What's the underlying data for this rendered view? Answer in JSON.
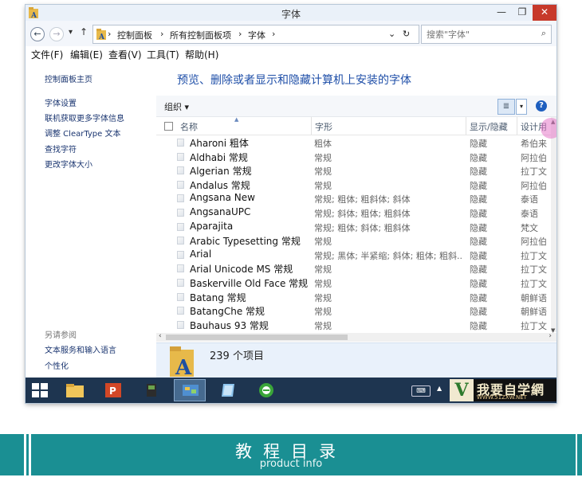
{
  "window": {
    "title": "字体",
    "min_glyph": "—",
    "max_glyph": "❐",
    "close_glyph": "✕"
  },
  "address": {
    "crumbs": [
      "控制面板",
      "所有控制面板项",
      "字体"
    ],
    "separator": "›",
    "search_placeholder": "搜索\"字体\"",
    "back_glyph": "←",
    "forward_glyph": "→",
    "recent_glyph": "▾",
    "up_glyph": "↑",
    "dropdown_glyph": "⌄",
    "refresh_glyph": "↻",
    "search_glyph": "⌕"
  },
  "menu": [
    "文件(F)",
    "编辑(E)",
    "查看(V)",
    "工具(T)",
    "帮助(H)"
  ],
  "sidebar": {
    "home": "控制面板主页",
    "links": [
      "字体设置",
      "联机获取更多字体信息",
      "调整 ClearType 文本",
      "查找字符",
      "更改字体大小"
    ],
    "see_also": "另请参阅",
    "see_also_links": [
      "文本服务和输入语言",
      "个性化"
    ]
  },
  "main": {
    "heading": "预览、删除或者显示和隐藏计算机上安装的字体",
    "organize": "组织 ▾",
    "view_glyph": "≣",
    "view_dd": "▾",
    "help": "?",
    "columns": {
      "name": "名称",
      "style": "字形",
      "state": "显示/隐藏",
      "designer": "设计用"
    },
    "rows": [
      {
        "name": "Aharoni 粗体",
        "style": "粗体",
        "state": "隐藏",
        "designer": "希伯来"
      },
      {
        "name": "Aldhabi 常规",
        "style": "常规",
        "state": "隐藏",
        "designer": "阿拉伯"
      },
      {
        "name": "Algerian 常规",
        "style": "常规",
        "state": "隐藏",
        "designer": "拉丁文"
      },
      {
        "name": "Andalus 常规",
        "style": "常规",
        "state": "隐藏",
        "designer": "阿拉伯"
      },
      {
        "name": "Angsana New",
        "style": "常规; 粗体; 粗斜体; 斜体",
        "state": "隐藏",
        "designer": "泰语"
      },
      {
        "name": "AngsanaUPC",
        "style": "常规; 斜体; 粗体; 粗斜体",
        "state": "隐藏",
        "designer": "泰语"
      },
      {
        "name": "Aparajita",
        "style": "常规; 粗体; 斜体; 粗斜体",
        "state": "隐藏",
        "designer": "梵文"
      },
      {
        "name": "Arabic Typesetting 常规",
        "style": "常规",
        "state": "隐藏",
        "designer": "阿拉伯"
      },
      {
        "name": "Arial",
        "style": "常规; 黑体; 半紧缩; 斜体; 粗体; 粗斜...",
        "state": "隐藏",
        "designer": "拉丁文"
      },
      {
        "name": "Arial Unicode MS 常规",
        "style": "常规",
        "state": "隐藏",
        "designer": "拉丁文"
      },
      {
        "name": "Baskerville Old Face 常规",
        "style": "常规",
        "state": "隐藏",
        "designer": "拉丁文"
      },
      {
        "name": "Batang 常规",
        "style": "常规",
        "state": "隐藏",
        "designer": "朝鲜语"
      },
      {
        "name": "BatangChe 常规",
        "style": "常规",
        "state": "隐藏",
        "designer": "朝鲜语"
      },
      {
        "name": "Bauhaus 93 常规",
        "style": "常规",
        "state": "隐藏",
        "designer": "拉丁文"
      }
    ],
    "item_count": "239 个项目"
  },
  "taskbar": {
    "apps": [
      "start-button",
      "file-explorer",
      "powerpoint",
      "camtasia",
      "control-panel",
      "notepad",
      "browser"
    ],
    "keyboard_glyph": "⌨",
    "tray_glyph": "▲",
    "brand_v": "V",
    "brand_text": "我要自学網",
    "brand_url": "WWW.51ZXW.NET"
  },
  "banner": {
    "title": "教程目录",
    "subtitle": "product info"
  },
  "colors": {
    "banner_teal": "#1a8f93",
    "close_red": "#c7392a",
    "link_blue": "#1a3570",
    "heading_blue": "#1f4fa8",
    "taskbar": "#1e3550"
  }
}
